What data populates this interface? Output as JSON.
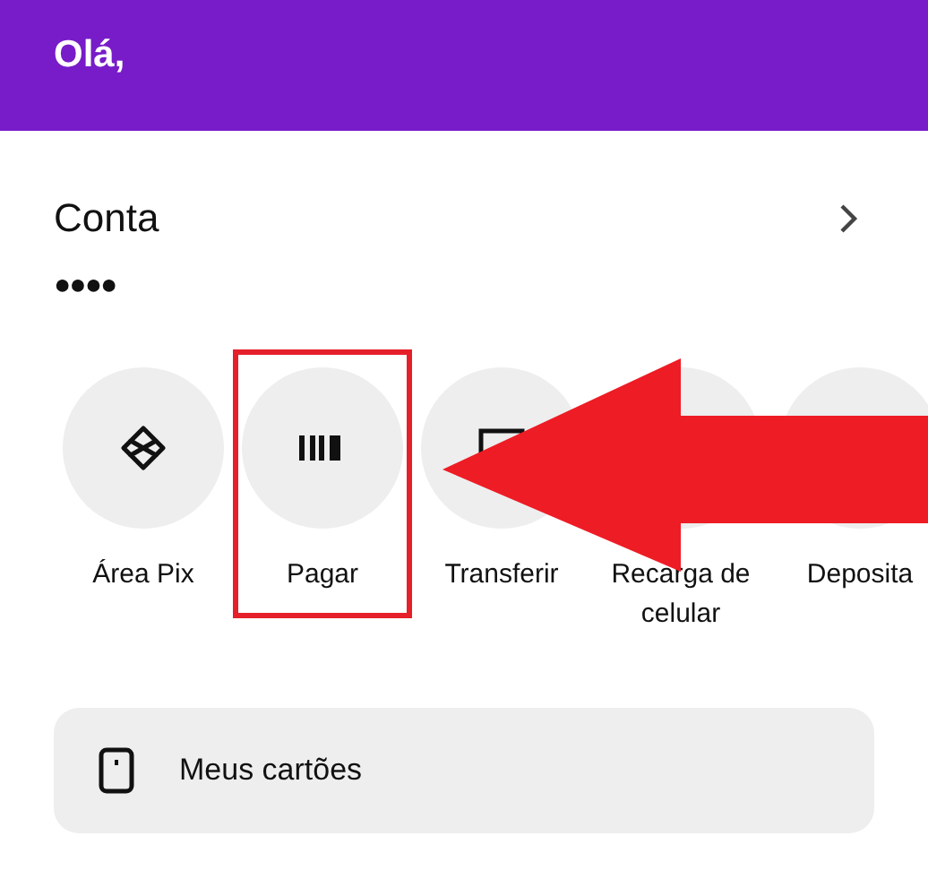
{
  "header": {
    "title": "Olá,"
  },
  "account": {
    "title": "Conta",
    "balance": "●●●●"
  },
  "actions": [
    {
      "label": "Área Pix",
      "highlighted": false
    },
    {
      "label": "Pagar",
      "highlighted": true
    },
    {
      "label": "Transferir",
      "highlighted": false
    },
    {
      "label": "Recarga de celular",
      "highlighted": false
    },
    {
      "label": "Deposita",
      "highlighted": false
    }
  ],
  "cards_item": {
    "label": "Meus cartões"
  }
}
